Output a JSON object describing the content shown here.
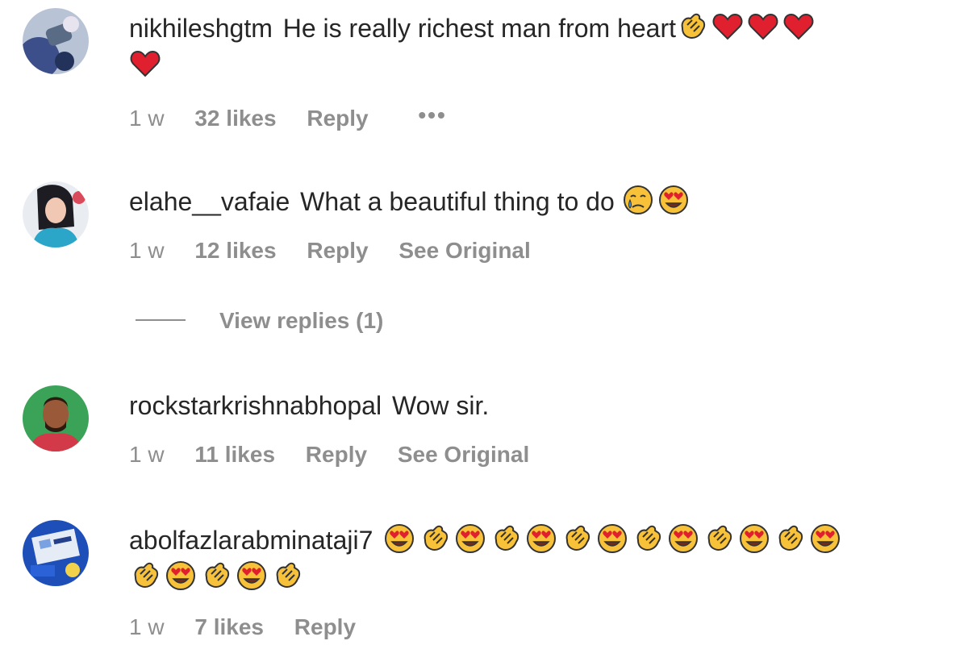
{
  "comments": [
    {
      "username": "nikhileshgtm",
      "text": "He is really richest man from heart",
      "line1_emojis": [
        "clapping-hands",
        "red-heart",
        "red-heart",
        "red-heart"
      ],
      "line2_emojis": [
        "red-heart"
      ],
      "time": "1 w",
      "likes": "32 likes",
      "reply": "Reply",
      "more": "•••"
    },
    {
      "username": "elahe__vafaie",
      "text": "What a beautiful thing to do",
      "line1_emojis": [
        "crying-face",
        "heart-eyes-face"
      ],
      "time": "1 w",
      "likes": "12 likes",
      "reply": "Reply",
      "see_original": "See Original",
      "view_replies": "View replies (1)"
    },
    {
      "username": "rockstarkrishnabhopal",
      "text": "Wow sir.",
      "time": "1 w",
      "likes": "11 likes",
      "reply": "Reply",
      "see_original": "See Original"
    },
    {
      "username": "abolfazlarabminataji7",
      "text": "",
      "line1_emojis": [
        "heart-eyes-face",
        "clapping-hands",
        "heart-eyes-face",
        "clapping-hands",
        "heart-eyes-face",
        "clapping-hands",
        "heart-eyes-face",
        "clapping-hands",
        "heart-eyes-face",
        "clapping-hands",
        "heart-eyes-face",
        "clapping-hands",
        "heart-eyes-face"
      ],
      "line2_emojis": [
        "clapping-hands",
        "heart-eyes-face",
        "clapping-hands",
        "heart-eyes-face",
        "clapping-hands"
      ],
      "time": "1 w",
      "likes": "7 likes",
      "reply": "Reply"
    }
  ],
  "colors": {
    "text": "#262626",
    "meta": "#8e8e8e",
    "heart": "#e0202e",
    "emoji_face": "#f7c23a"
  }
}
